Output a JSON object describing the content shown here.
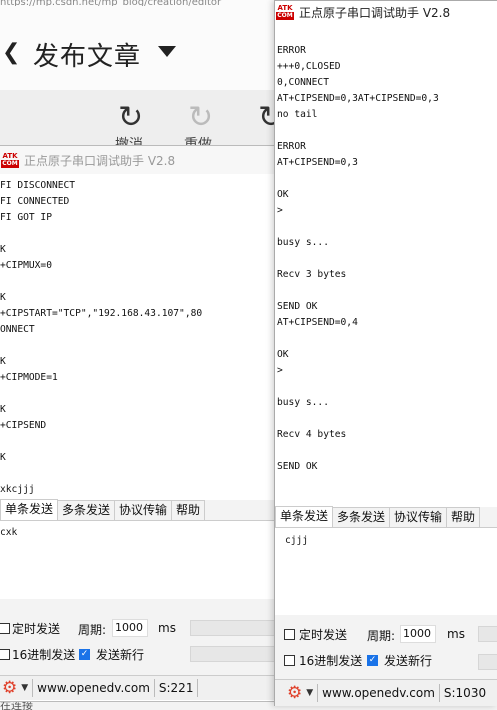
{
  "background": {
    "url_fragment": "https://mp.csdn.net/mp_blog/creation/editor",
    "page_title": "发布文章",
    "toolbar": [
      {
        "label": "撤消"
      },
      {
        "label": "重做"
      }
    ],
    "bottom_fragment": "在连接"
  },
  "window1": {
    "title": "正点原子串口调试助手 V2.8",
    "receive_lines": [
      "FI DISCONNECT",
      "FI CONNECTED",
      "FI GOT IP",
      "",
      "K",
      "+CIPMUX=0",
      "",
      "K",
      "+CIPSTART=\"TCP\",\"192.168.43.107\",80",
      "ONNECT",
      "",
      "K",
      "+CIPMODE=1",
      "",
      "K",
      "+CIPSEND",
      "",
      "K",
      "",
      "xkcjjj"
    ],
    "tabs": [
      "单条发送",
      "多条发送",
      "协议传输",
      "帮助"
    ],
    "send_text": "cxk",
    "timed_send": "定时发送",
    "period_label": "周期:",
    "period_value": "1000",
    "period_unit": "ms",
    "hex_send": "16进制发送",
    "newline_send": "发送新行",
    "website": "www.openedv.com",
    "sent_count": "S:221"
  },
  "window2": {
    "title": "正点原子串口调试助手 V2.8",
    "receive_lines": [
      "",
      "ERROR",
      "+++0,CLOSED",
      "0,CONNECT",
      "AT+CIPSEND=0,3AT+CIPSEND=0,3",
      "no tail",
      "",
      "ERROR",
      "AT+CIPSEND=0,3",
      "",
      "OK",
      ">",
      "",
      "busy s...",
      "",
      "Recv 3 bytes",
      "",
      "SEND OK",
      "AT+CIPSEND=0,4",
      "",
      "OK",
      ">",
      "",
      "busy s...",
      "",
      "Recv 4 bytes",
      "",
      "SEND OK"
    ],
    "tabs": [
      "单条发送",
      "多条发送",
      "协议传输",
      "帮助"
    ],
    "send_text": "cjjj",
    "timed_send": "定时发送",
    "period_label": "周期:",
    "period_value": "1000",
    "period_unit": "ms",
    "hex_send": "16进制发送",
    "newline_send": "发送新行",
    "website": "www.openedv.com",
    "sent_count": "S:1030"
  },
  "logo_text": {
    "top": "ATK",
    "bottom": "COM"
  },
  "icons": [
    "undo-icon",
    "redo-icon",
    "gear-icon",
    "chevron-down-icon",
    "back-chevron-icon",
    "caret-down-icon"
  ],
  "colors": {
    "accent_red": "#e0402a",
    "logo_red": "#cc0000",
    "check_blue": "#1a73e8"
  }
}
